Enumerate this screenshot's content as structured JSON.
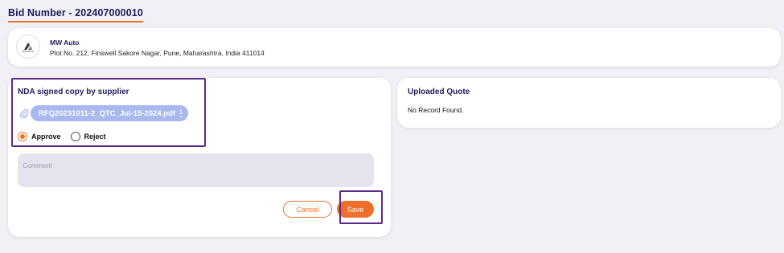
{
  "bid": {
    "title": "Bid Number - 202407000010"
  },
  "supplier": {
    "logo_text": "MW AUTO",
    "name": "MW Auto",
    "address": "Plot No. 212, Finswell Sakore Nagar, Pune, Maharashtra, India 411014"
  },
  "nda": {
    "title": "NDA signed copy by supplier",
    "file_name": "RFQ20231011-2_QTC_Jul-15-2024.pdf",
    "approve_label": "Approve",
    "reject_label": "Reject",
    "selected": "Approve",
    "comment_placeholder": "Comment",
    "comment_value": "",
    "cancel_label": "Cancel",
    "save_label": "Save"
  },
  "quote": {
    "title": "Uploaded Quote",
    "empty_text": "No Record Found."
  },
  "colors": {
    "accent": "#e8732d",
    "chip": "#a9b9f0",
    "heading": "#1e1e5a",
    "highlight": "#5b2a86",
    "background": "#f1f0f6"
  },
  "icons": [
    "company-logo",
    "paperclip-icon",
    "kebab-menu-icon"
  ]
}
